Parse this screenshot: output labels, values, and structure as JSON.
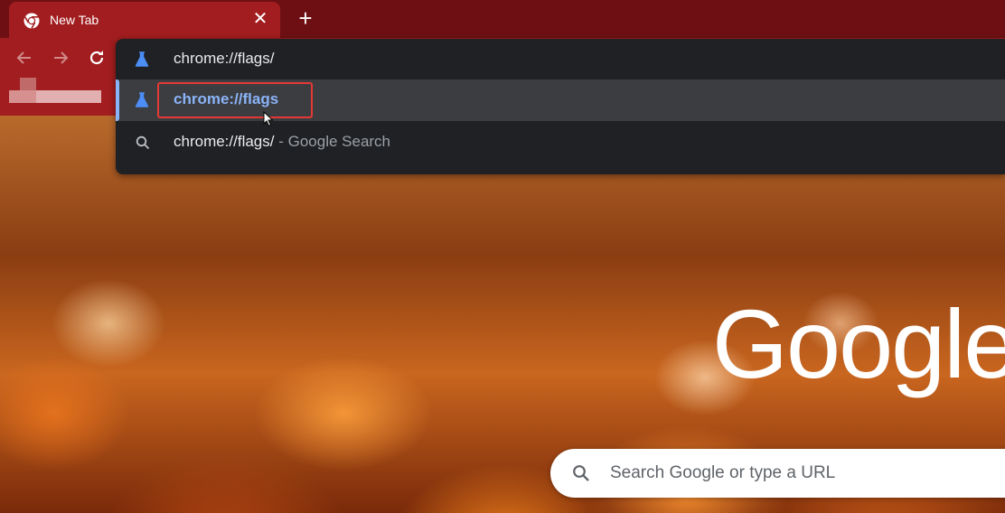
{
  "tab": {
    "title": "New Tab",
    "close_label": "✕"
  },
  "new_tab_label": "+",
  "omnibox": {
    "suggestions": [
      {
        "text": "chrome://flags/",
        "icon": "flask-icon"
      },
      {
        "text": "chrome://flags",
        "icon": "flask-icon",
        "selected": true
      },
      {
        "text": "chrome://flags/",
        "suffix": " - Google Search",
        "icon": "search-icon"
      }
    ]
  },
  "google_logo": "Google",
  "search": {
    "placeholder": "Search Google or type a URL"
  },
  "colors": {
    "tab_strip": "#6e1013",
    "toolbar": "#a21d1f",
    "dropdown": "#202124",
    "selected_row": "#3c3d40",
    "accent_blue": "#8ab4f8",
    "highlight_red": "#e53935"
  }
}
